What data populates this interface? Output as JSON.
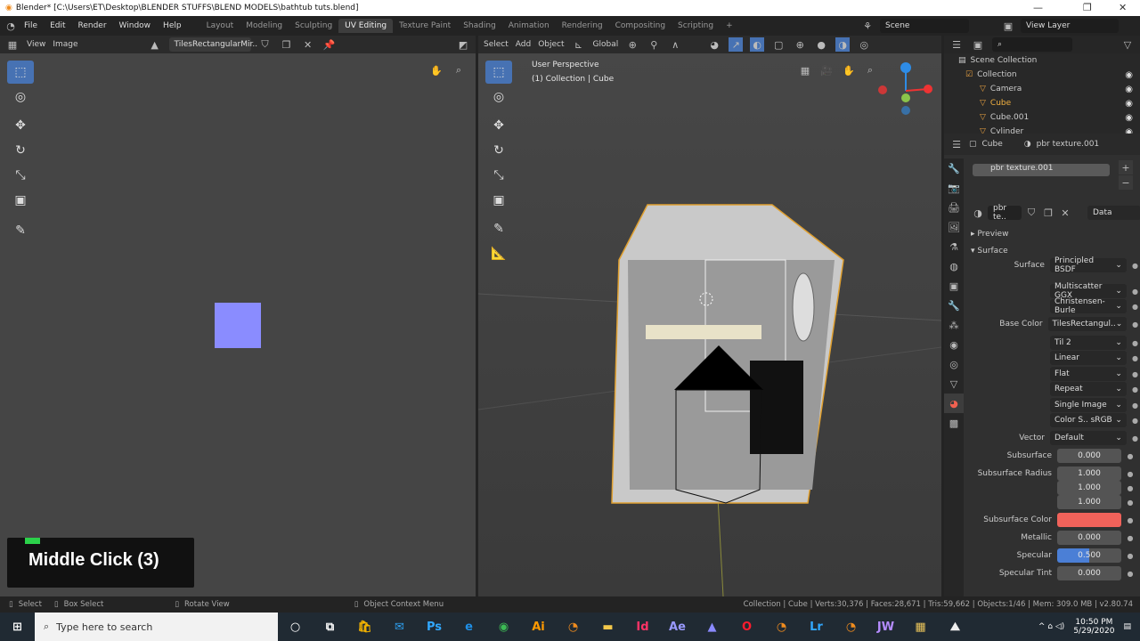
{
  "window": {
    "title": "Blender* [C:\\Users\\ET\\Desktop\\BLENDER STUFFS\\BLEND MODELS\\bathtub tuts.blend]",
    "minimize": "—",
    "maximize": "❐",
    "close": "✕"
  },
  "menu": [
    "File",
    "Edit",
    "Render",
    "Window",
    "Help"
  ],
  "workspaces": [
    {
      "label": "Layout"
    },
    {
      "label": "Modeling"
    },
    {
      "label": "Sculpting"
    },
    {
      "label": "UV Editing",
      "active": true
    },
    {
      "label": "Texture Paint"
    },
    {
      "label": "Shading"
    },
    {
      "label": "Animation"
    },
    {
      "label": "Rendering"
    },
    {
      "label": "Compositing"
    },
    {
      "label": "Scripting"
    },
    {
      "label": "+"
    }
  ],
  "scene": "Scene",
  "view_layer": "View Layer",
  "uv_header": {
    "view": "View",
    "image": "Image",
    "image_name": "TilesRectangularMir.."
  },
  "uv_square_color": "#8a8cff",
  "vp_header": {
    "select": "Select",
    "add": "Add",
    "object": "Object",
    "orientation": "Global"
  },
  "viewport": {
    "mode_text": "User Perspective",
    "context_text": "(1) Collection | Cube"
  },
  "outliner": {
    "root": "Scene Collection",
    "items": [
      {
        "name": "Collection",
        "level": 0
      },
      {
        "name": "Camera",
        "level": 1
      },
      {
        "name": "Cube",
        "level": 1,
        "active": true
      },
      {
        "name": "Cube.001",
        "level": 1
      },
      {
        "name": "Cylinder",
        "level": 1
      }
    ]
  },
  "properties": {
    "object": "Cube",
    "material": "pbr texture.001",
    "slot": "pbr texture.001",
    "mat_short": "pbr te..",
    "link": "Data",
    "preview": "Preview",
    "surface_panel": "Surface",
    "rows": [
      {
        "label": "Surface",
        "value": "Principled BSDF",
        "kind": "drop"
      },
      {
        "label": "",
        "value": "Multiscatter GGX",
        "kind": "drop"
      },
      {
        "label": "",
        "value": "Christensen-Burle",
        "kind": "drop"
      },
      {
        "label": "Base Color",
        "value": "TilesRectangul..",
        "kind": "drop"
      },
      {
        "label": "",
        "value": "Til  2",
        "kind": "drop"
      },
      {
        "label": "",
        "value": "Linear",
        "kind": "drop"
      },
      {
        "label": "",
        "value": "Flat",
        "kind": "drop"
      },
      {
        "label": "",
        "value": "Repeat",
        "kind": "drop"
      },
      {
        "label": "",
        "value": "Single Image",
        "kind": "drop"
      },
      {
        "label": "",
        "value": "Color S..   sRGB",
        "kind": "drop"
      },
      {
        "label": "Vector",
        "value": "Default",
        "kind": "drop"
      },
      {
        "label": "Subsurface",
        "value": "0.000",
        "kind": "num"
      },
      {
        "label": "Subsurface Radius",
        "value": "1.000",
        "kind": "num"
      },
      {
        "label": "",
        "value": "1.000",
        "kind": "num"
      },
      {
        "label": "",
        "value": "1.000",
        "kind": "num"
      },
      {
        "label": "Subsurface Color",
        "value": "",
        "kind": "color"
      },
      {
        "label": "Metallic",
        "value": "0.000",
        "kind": "num"
      },
      {
        "label": "Specular",
        "value": "0.500",
        "kind": "slider",
        "fraction": 0.5
      },
      {
        "label": "Specular Tint",
        "value": "0.000",
        "kind": "num"
      }
    ],
    "subsurface_color": "#f0625a",
    "specular_fill": "#4b7fd6"
  },
  "status": {
    "select": "Select",
    "box_select": "Box Select",
    "rotate": "Rotate View",
    "context": "Object Context Menu",
    "stats": "Collection | Cube | Verts:30,376 | Faces:28,671 | Tris:59,662 | Objects:1/46 | Mem: 309.0 MB | v2.80.74"
  },
  "taskbar": {
    "search_placeholder": "Type here to search",
    "time": "10:50 PM",
    "date": "5/29/2020",
    "apps": [
      {
        "icon": "store-icon",
        "glyph": "🛍",
        "color": "#f5b400"
      },
      {
        "icon": "mail-icon",
        "glyph": "✉",
        "color": "#2ea0f0"
      },
      {
        "icon": "photoshop-icon",
        "glyph": "Ps",
        "color": "#31a8ff"
      },
      {
        "icon": "edge-icon",
        "glyph": "e",
        "color": "#1f8fe6"
      },
      {
        "icon": "chrome-icon",
        "glyph": "◉",
        "color": "#3cba54"
      },
      {
        "icon": "illustrator-icon",
        "glyph": "Ai",
        "color": "#ff9a00"
      },
      {
        "icon": "blender-icon",
        "glyph": "◔",
        "color": "#f08c1e"
      },
      {
        "icon": "folder-icon",
        "glyph": "▬",
        "color": "#f3c84b"
      },
      {
        "icon": "indesign-icon",
        "glyph": "Id",
        "color": "#ff3366"
      },
      {
        "icon": "after-effects-icon",
        "glyph": "Ae",
        "color": "#9999ff"
      },
      {
        "icon": "premiere-icon",
        "glyph": "▲",
        "color": "#8a8aff"
      },
      {
        "icon": "opera-icon",
        "glyph": "O",
        "color": "#ff1b2d"
      },
      {
        "icon": "blender-icon",
        "glyph": "◔",
        "color": "#f08c1e"
      },
      {
        "icon": "lightroom-icon",
        "glyph": "Lr",
        "color": "#31a8ff"
      },
      {
        "icon": "blender-icon",
        "glyph": "◔",
        "color": "#f08c1e"
      },
      {
        "icon": "jw-icon",
        "glyph": "JW",
        "color": "#b58cff"
      },
      {
        "icon": "archive-icon",
        "glyph": "▦",
        "color": "#e8c35a"
      },
      {
        "icon": "photos-icon",
        "glyph": "⛰",
        "color": "#eee"
      }
    ]
  },
  "overlay": {
    "text": "Middle Click (3)",
    "indicator_color": "#2bd14a"
  },
  "accent": "#4772b3"
}
